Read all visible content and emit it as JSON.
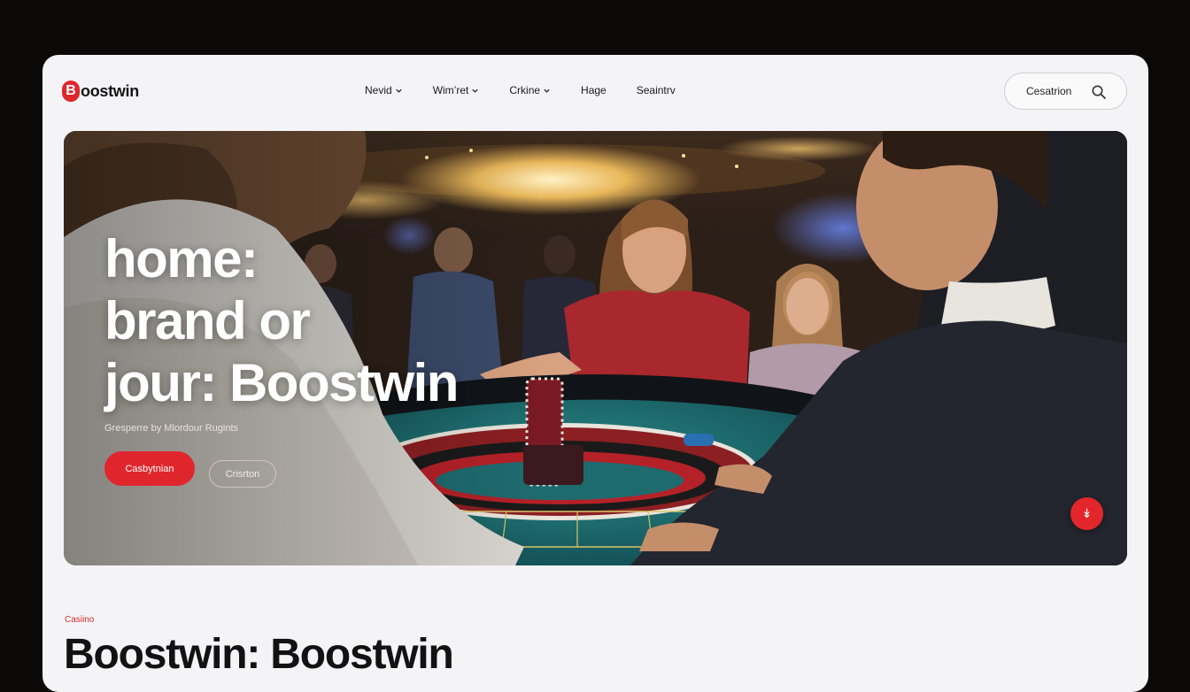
{
  "brand": {
    "mark": "B",
    "name": "oostwin"
  },
  "nav": {
    "items": [
      {
        "label": "Nevid",
        "has_dropdown": true
      },
      {
        "label": "Wim’ret",
        "has_dropdown": true
      },
      {
        "label": "Crkine",
        "has_dropdown": true
      },
      {
        "label": "Hage",
        "has_dropdown": false
      },
      {
        "label": "Seaintrv",
        "has_dropdown": false
      }
    ]
  },
  "search": {
    "label": "Cesatrion",
    "icon": "search-icon"
  },
  "hero": {
    "title_line1": "home:",
    "title_line2": "brand or",
    "title_line3": "jour: Boostwin",
    "subtitle": "Gresperre by Mlordour Rugints",
    "primary_button": "Casbytnian",
    "secondary_button": "Crisrton",
    "fab_icon": "chevrons-down-icon",
    "fab_glyph": "↡"
  },
  "section": {
    "eyebrow": "Casiino",
    "title": "Boostwin: Boostwin"
  },
  "colors": {
    "accent": "#e0262d",
    "card_bg": "#f4f4f6",
    "page_bg": "#0b0908",
    "felt": "#1f6f72"
  }
}
